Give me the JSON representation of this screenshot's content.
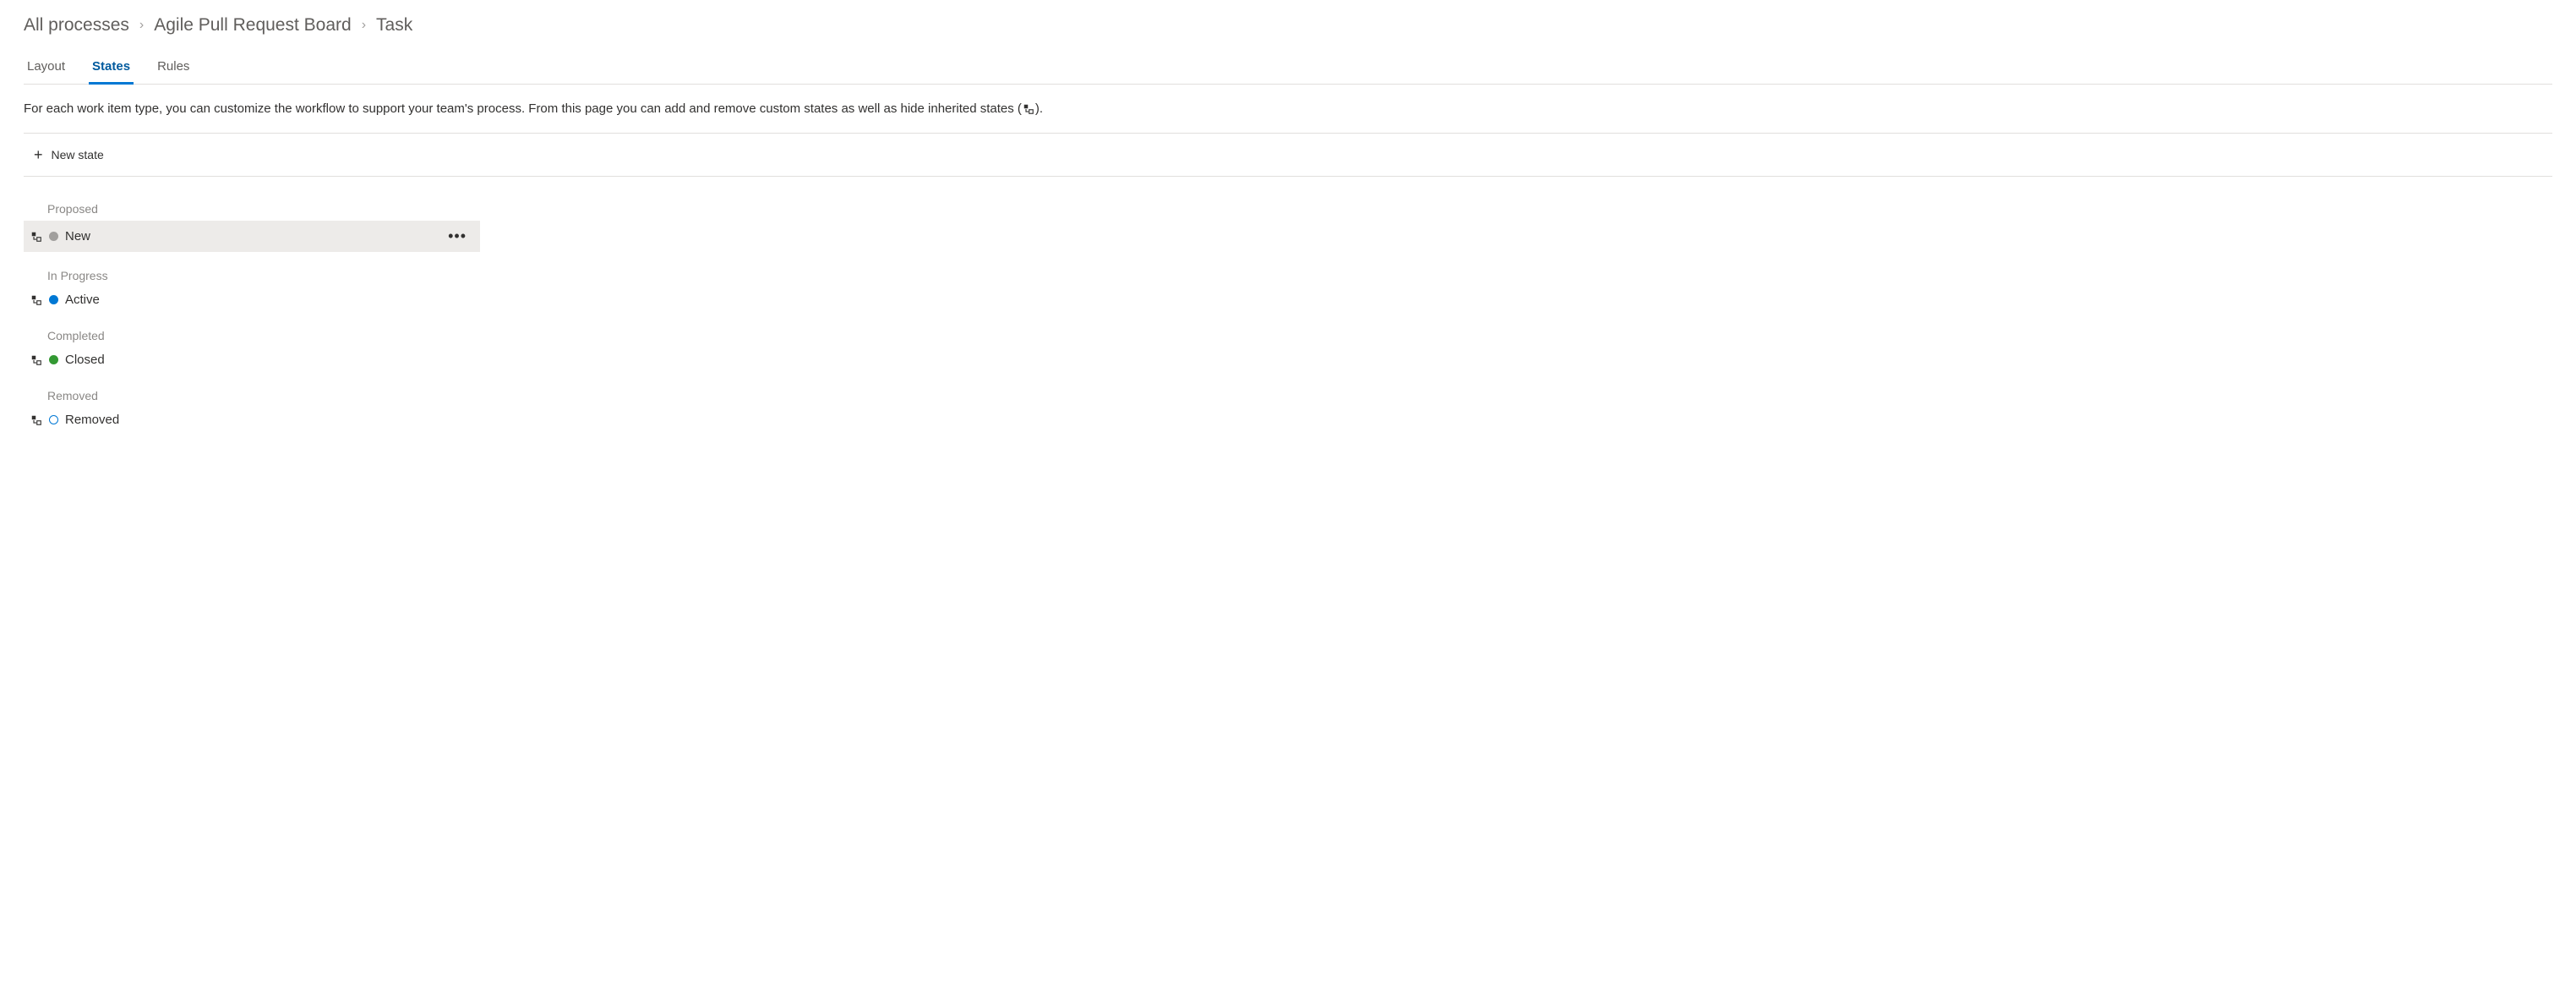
{
  "breadcrumb": {
    "root": "All processes",
    "process": "Agile Pull Request Board",
    "item": "Task"
  },
  "tabs": [
    {
      "id": "layout",
      "label": "Layout",
      "active": false
    },
    {
      "id": "states",
      "label": "States",
      "active": true
    },
    {
      "id": "rules",
      "label": "Rules",
      "active": false
    }
  ],
  "description_pre": "For each work item type, you can customize the workflow to support your team's process. From this page you can add and remove custom states as well as hide inherited states (",
  "description_post": ").",
  "toolbar": {
    "new_state_label": "New state"
  },
  "categories": [
    {
      "name": "Proposed",
      "states": [
        {
          "name": "New",
          "color": "grey",
          "inherited": true,
          "selected": true
        }
      ]
    },
    {
      "name": "In Progress",
      "states": [
        {
          "name": "Active",
          "color": "blue",
          "inherited": true,
          "selected": false
        }
      ]
    },
    {
      "name": "Completed",
      "states": [
        {
          "name": "Closed",
          "color": "green",
          "inherited": true,
          "selected": false
        }
      ]
    },
    {
      "name": "Removed",
      "states": [
        {
          "name": "Removed",
          "color": "white-outline",
          "inherited": true,
          "selected": false
        }
      ]
    }
  ]
}
